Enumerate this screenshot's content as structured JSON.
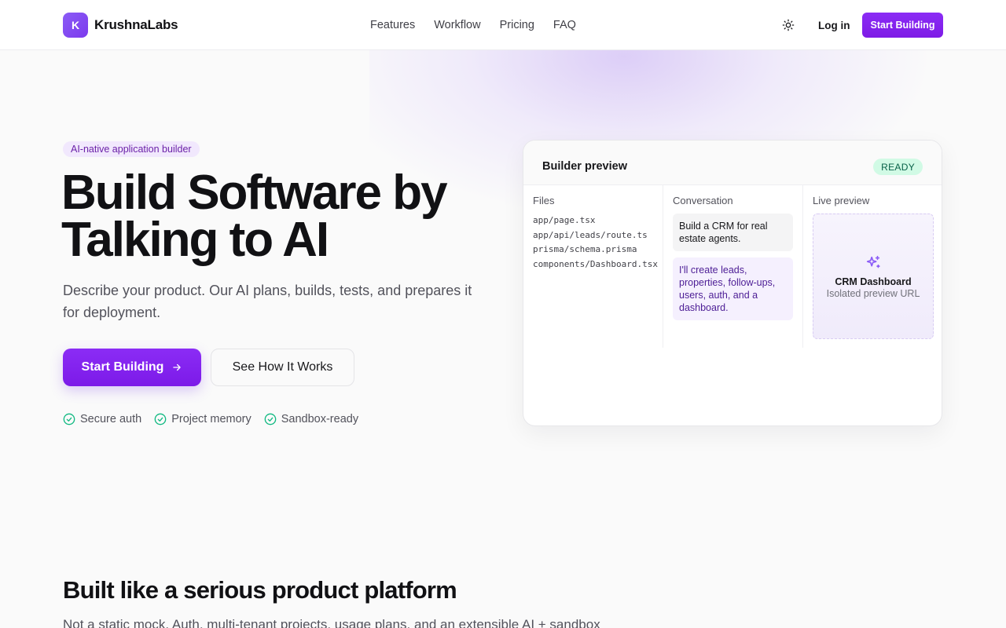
{
  "header": {
    "brand_initial": "K",
    "brand_name": "KrushnaLabs",
    "nav": [
      "Features",
      "Workflow",
      "Pricing",
      "FAQ"
    ],
    "theme_icon": "sun-icon",
    "login_label": "Log in",
    "cta_label": "Start Building"
  },
  "hero": {
    "pill": "AI-native application builder",
    "title_line1": "Build Software by",
    "title_line2": "Talking to AI",
    "subtitle": "Describe your product. Our AI plans, builds, tests, and prepares it for deployment.",
    "primary_cta": "Start Building",
    "secondary_cta": "See How It Works",
    "features": [
      "Secure auth",
      "Project memory",
      "Sandbox-ready"
    ]
  },
  "preview": {
    "title": "Builder preview",
    "status": "READY",
    "files_label": "Files",
    "files": [
      "app/page.tsx",
      "app/api/leads/route.ts",
      "prisma/schema.prisma",
      "components/Dashboard.tsx"
    ],
    "conversation_label": "Conversation",
    "user_message": "Build a CRM for real estate agents.",
    "ai_message": "I'll create leads, properties, follow-ups, users, auth, and a dashboard.",
    "live_label": "Live preview",
    "live_title": "CRM Dashboard",
    "live_subtitle": "Isolated preview URL"
  },
  "section": {
    "title": "Built like a serious product platform",
    "subtitle": "Not a static mock. Auth, multi-tenant projects, usage plans, and an extensible AI + sandbox"
  },
  "colors": {
    "accent": "#7e22ce",
    "accent_light": "#f1e8fd",
    "success": "#10b981",
    "ready_bg": "#d1fae5"
  }
}
